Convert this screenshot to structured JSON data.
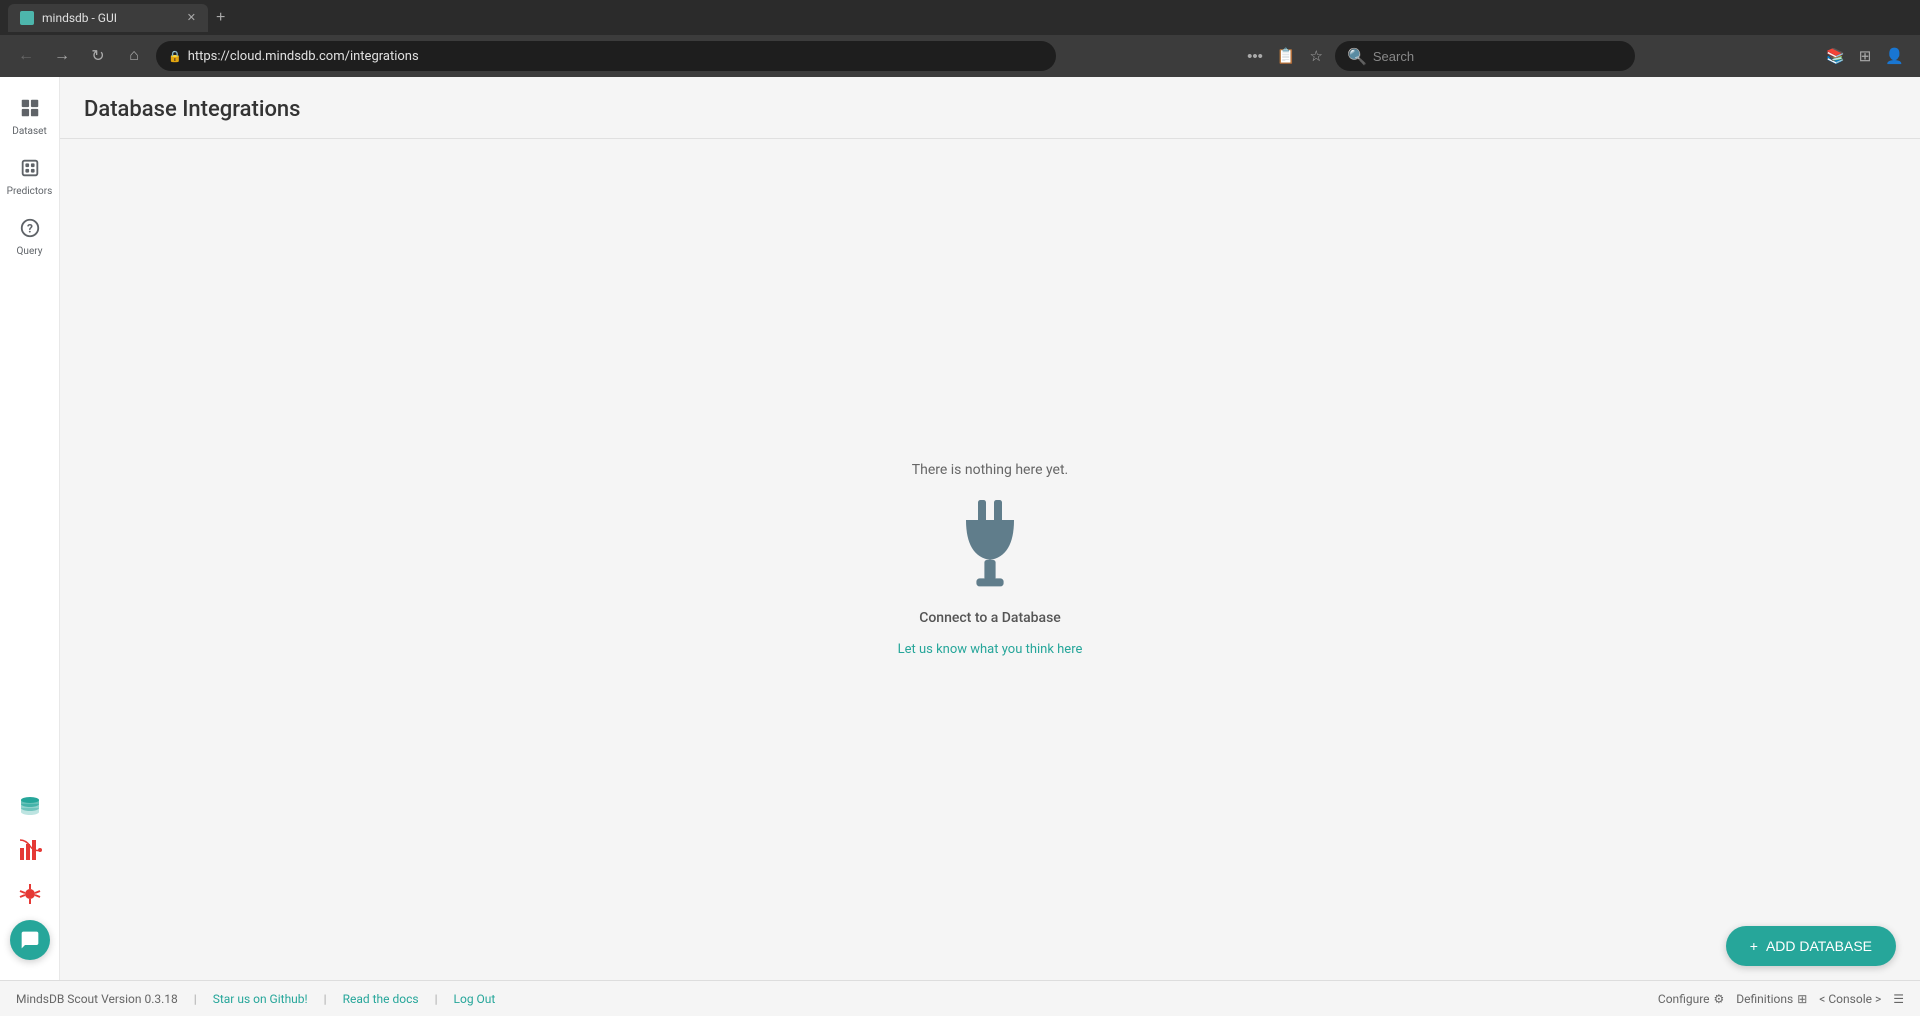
{
  "browser": {
    "tab_title": "mindsdb - GUI",
    "tab_new_label": "+",
    "url": "https://cloud.mindsdb.com/integrations",
    "search_placeholder": "Search"
  },
  "nav": {
    "back_icon": "←",
    "forward_icon": "→",
    "refresh_icon": "↻",
    "home_icon": "⌂",
    "lock_icon": "🔒",
    "more_icon": "•••",
    "bookmark_icon": "☆",
    "star_icon": "★",
    "profile_icon": "👤"
  },
  "sidebar": {
    "items": [
      {
        "id": "dataset",
        "label": "Dataset",
        "active": false
      },
      {
        "id": "predictors",
        "label": "Predictors",
        "active": false
      },
      {
        "id": "query",
        "label": "Query",
        "active": false
      }
    ],
    "bottom": [
      {
        "id": "database",
        "icon": "🗄"
      },
      {
        "id": "analytics",
        "icon": "🏙"
      },
      {
        "id": "bug",
        "icon": "🐛"
      },
      {
        "id": "chat",
        "icon": "💬"
      }
    ]
  },
  "page": {
    "title": "Database Integrations",
    "empty_text": "There is nothing here yet.",
    "connect_label": "Connect to a Database",
    "feedback_text": "Let us know what you think here"
  },
  "add_button": {
    "label": "ADD DATABASE",
    "icon": "+"
  },
  "footer": {
    "version": "MindsDB Scout Version 0.3.18",
    "github_link": "Star us on Github!",
    "separator1": "|",
    "docs_link": "Read the docs",
    "separator2": "|",
    "logout_link": "Log Out",
    "configure_label": "Configure",
    "definitions_label": "Definitions",
    "console_label": "< Console >",
    "menu_icon": "☰"
  }
}
